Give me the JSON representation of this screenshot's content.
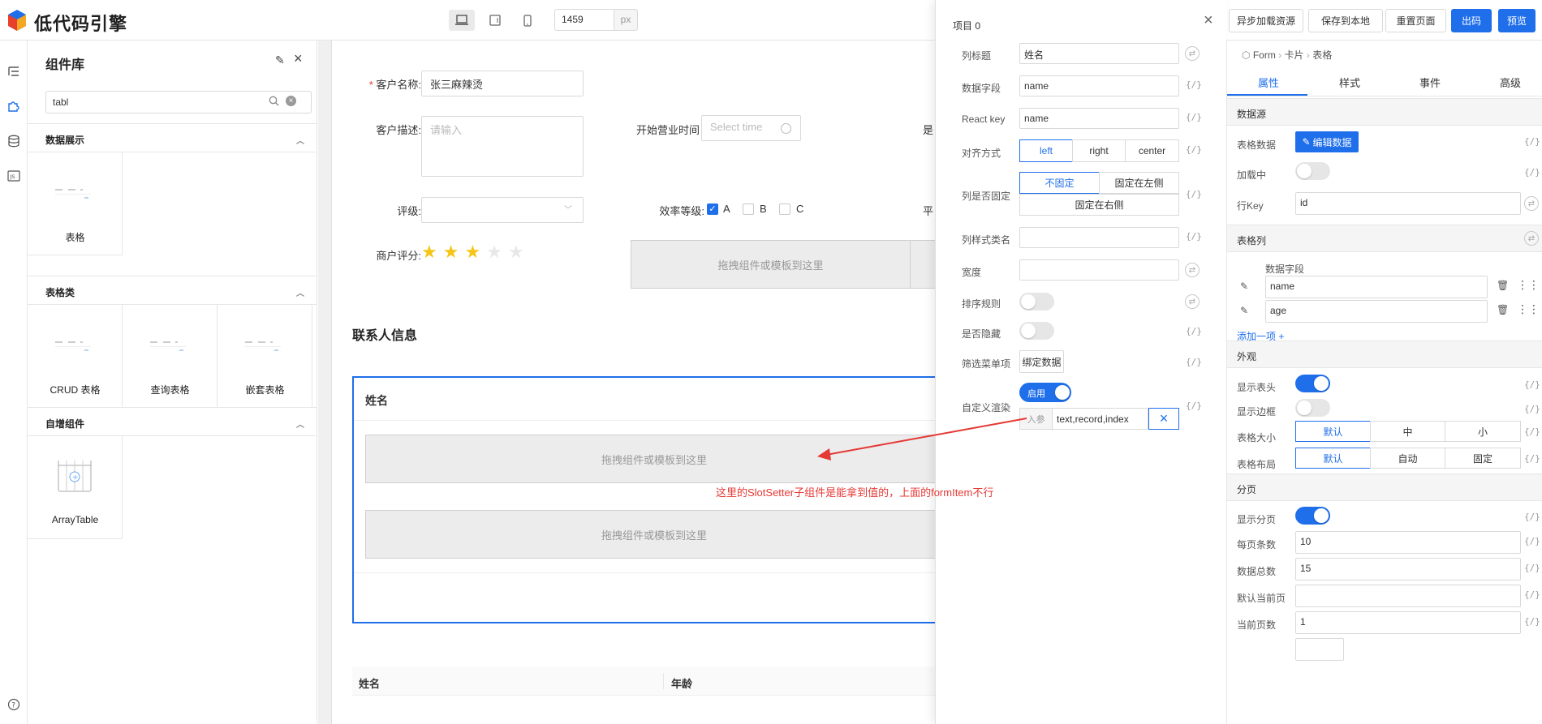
{
  "topbar": {
    "logo_text": "低代码引擎",
    "canvas_width": "1459",
    "unit": "px",
    "buttons": [
      "异步加载资源",
      "保存到本地",
      "重置页面",
      "出码",
      "预览"
    ]
  },
  "library": {
    "title": "组件库",
    "search_value": "tabl",
    "sections": [
      {
        "title": "数据展示",
        "items": [
          "表格"
        ]
      },
      {
        "title": "表格类",
        "items": [
          "CRUD 表格",
          "查询表格",
          "嵌套表格"
        ]
      },
      {
        "title": "自增组件",
        "items": [
          "ArrayTable"
        ]
      }
    ]
  },
  "canvas": {
    "customer_name_label": "客户名称:",
    "customer_name_value": "张三麻辣烫",
    "customer_desc_label": "客户描述:",
    "customer_desc_placeholder": "请输入",
    "open_time_label": "开始营业时间",
    "open_time_placeholder": "Select time",
    "cut_label_1": "是",
    "rating_label": "评级:",
    "efficiency_label": "效率等级:",
    "efficiency_options": [
      "A",
      "B",
      "C"
    ],
    "cut_label_2": "平",
    "merchant_score_label": "商户评分:",
    "stars_value": 3,
    "stars_total": 5,
    "dropzone_text": "拖拽组件或模板到这里",
    "contacts_title": "联系人信息",
    "table_header": "姓名",
    "dropzone_text_2": "拖拽组件或模板到这里",
    "dropzone_text_3": "拖拽组件或模板到这里",
    "bottom_table_headers": [
      "姓名",
      "年龄"
    ],
    "annotation": "这里的SlotSetter子组件是能拿到值的，上面的formItem不行"
  },
  "panel": {
    "title": "项目 0",
    "rows": {
      "column_title_label": "列标题",
      "column_title_value": "姓名",
      "data_field_label": "数据字段",
      "data_field_value": "name",
      "react_key_label": "React key",
      "react_key_value": "name",
      "align_label": "对齐方式",
      "align_options": [
        "left",
        "right",
        "center"
      ],
      "fixed_label": "列是否固定",
      "fixed_options": [
        "不固定",
        "固定在左侧",
        "固定在右侧"
      ],
      "class_label": "列样式类名",
      "width_label": "宽度",
      "sort_label": "排序规则",
      "hidden_label": "是否隐藏",
      "filter_label": "筛选菜单项",
      "filter_button": "绑定数据",
      "render_label": "自定义渲染",
      "render_toggle": "启用",
      "params_label": "入参",
      "params_value": "text,record,index"
    }
  },
  "settings": {
    "breadcrumb": [
      "Form",
      "卡片",
      "表格"
    ],
    "tabs": [
      "属性",
      "样式",
      "事件",
      "高级"
    ],
    "datasource_title": "数据源",
    "table_data_label": "表格数据",
    "edit_data_button": "编辑数据",
    "loading_label": "加载中",
    "row_key_label": "行Key",
    "row_key_value": "id",
    "columns_title": "表格列",
    "columns_field_header": "数据字段",
    "columns": [
      "name",
      "age"
    ],
    "add_item": "添加一项 +",
    "appearance_title": "外观",
    "show_header_label": "显示表头",
    "show_border_label": "显示边框",
    "size_label": "表格大小",
    "size_options": [
      "默认",
      "中",
      "小"
    ],
    "layout_label": "表格布局",
    "layout_options": [
      "默认",
      "自动",
      "固定"
    ],
    "pagination_title": "分页",
    "show_pagination_label": "显示分页",
    "page_size_label": "每页条数",
    "page_size_value": "10",
    "total_label": "数据总数",
    "total_value": "15",
    "default_current_label": "默认当前页",
    "current_label": "当前页数",
    "current_value": "1"
  },
  "colors": {
    "primary": "#1f6feb",
    "arrow": "#e53935"
  }
}
